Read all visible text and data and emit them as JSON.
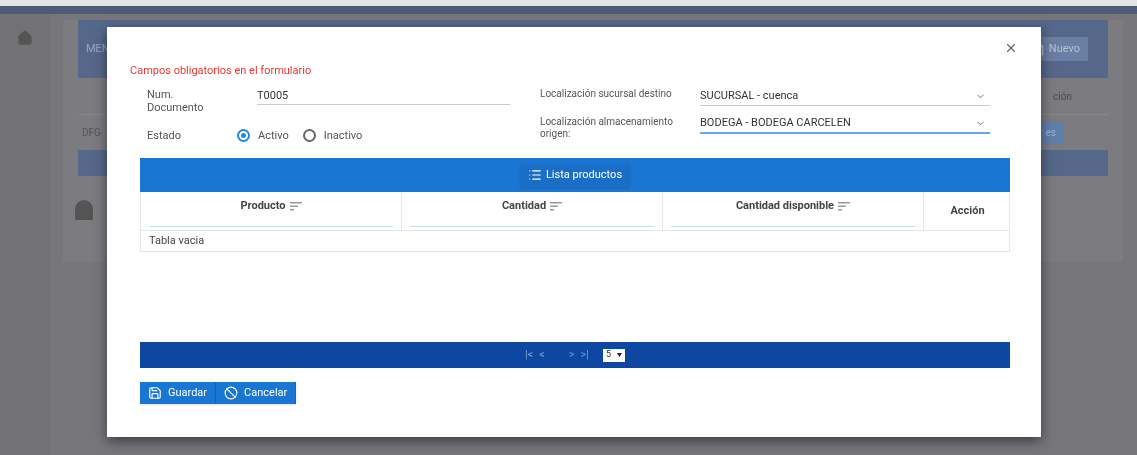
{
  "background": {
    "header_text": "MEN",
    "new_button": "Nuevo",
    "column_text": "ción",
    "row_text": "DFG",
    "row_button": "es"
  },
  "modal": {
    "required_note": "Campos obligatorios en el formulario",
    "doc_number": {
      "label": "Num. Documento",
      "value": "T0005"
    },
    "status": {
      "label": "Estado",
      "options": [
        {
          "label": "Activo",
          "selected": true
        },
        {
          "label": "Inactivo",
          "selected": false
        }
      ]
    },
    "selects": [
      {
        "label": "Localización sucursal destino",
        "value": "SUCURSAL - cuenca",
        "focused": false
      },
      {
        "label": "Localización almacenamiento origen:",
        "value": "BODEGA - BODEGA CARCELEN",
        "focused": true
      }
    ],
    "table": {
      "toolbar_button": "Lista productos",
      "columns": [
        {
          "label": "Producto",
          "sortable": true
        },
        {
          "label": "Cantidad",
          "sortable": true
        },
        {
          "label": "Cantidad disponible",
          "sortable": true
        },
        {
          "label": "Acción",
          "sortable": false
        }
      ],
      "empty_message": "Tabla vacia",
      "paginator": {
        "first": "|<",
        "prev": "<",
        "next": ">",
        "last": ">|",
        "rows_per_page": "5"
      }
    },
    "buttons": [
      {
        "kind": "save",
        "label": "Guardar"
      },
      {
        "kind": "cancel",
        "label": "Cancelar"
      }
    ]
  }
}
